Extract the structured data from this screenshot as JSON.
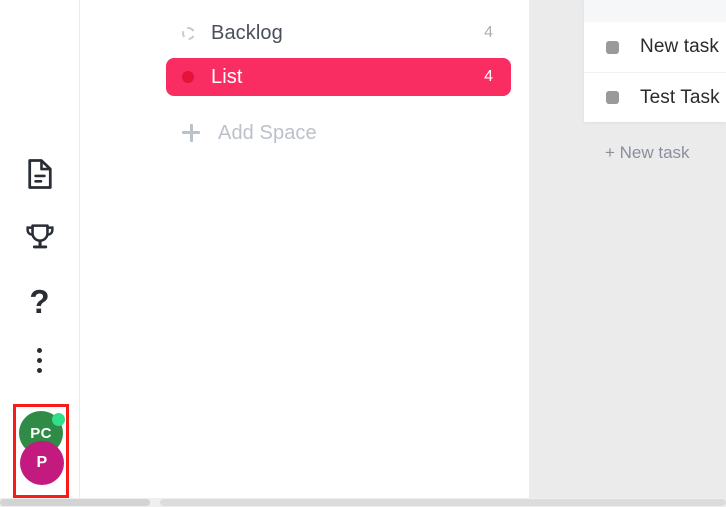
{
  "rail": {
    "icons": [
      {
        "name": "document-icon",
        "label": "Docs"
      },
      {
        "name": "trophy-icon",
        "label": "Goals"
      },
      {
        "name": "help-icon",
        "label": "?"
      },
      {
        "name": "more-options-icon",
        "label": "More"
      }
    ],
    "help_glyph": "?"
  },
  "avatars": {
    "highlighted": true,
    "highlight_color": "#f91a1a",
    "items": [
      {
        "name": "avatar-pc",
        "initials": "PC",
        "color": "#2f8b46",
        "presence": "online",
        "presence_color": "#2fe08a"
      },
      {
        "name": "avatar-p",
        "initials": "P",
        "color": "#c21a7e",
        "presence": "none"
      }
    ]
  },
  "annotation": {
    "type": "arrow",
    "direction": "left",
    "color": "#f90000"
  },
  "spaces": {
    "rows": [
      {
        "label": "Backlog",
        "count": "4",
        "marker": "dashed-circle-icon",
        "selected": false
      },
      {
        "label": "List",
        "count": "4",
        "marker": "red-dot-icon",
        "selected": true,
        "selected_bg": "#fa2d63",
        "dot_color": "#e5133a"
      }
    ],
    "add_space_label": "Add Space"
  },
  "board": {
    "background": "#ebebeb",
    "tasks": [
      {
        "title": "New task",
        "chip_color": "#9a9a9a"
      },
      {
        "title": "Test Task",
        "chip_color": "#9a9a9a"
      }
    ],
    "new_task_label": "+ New task"
  }
}
